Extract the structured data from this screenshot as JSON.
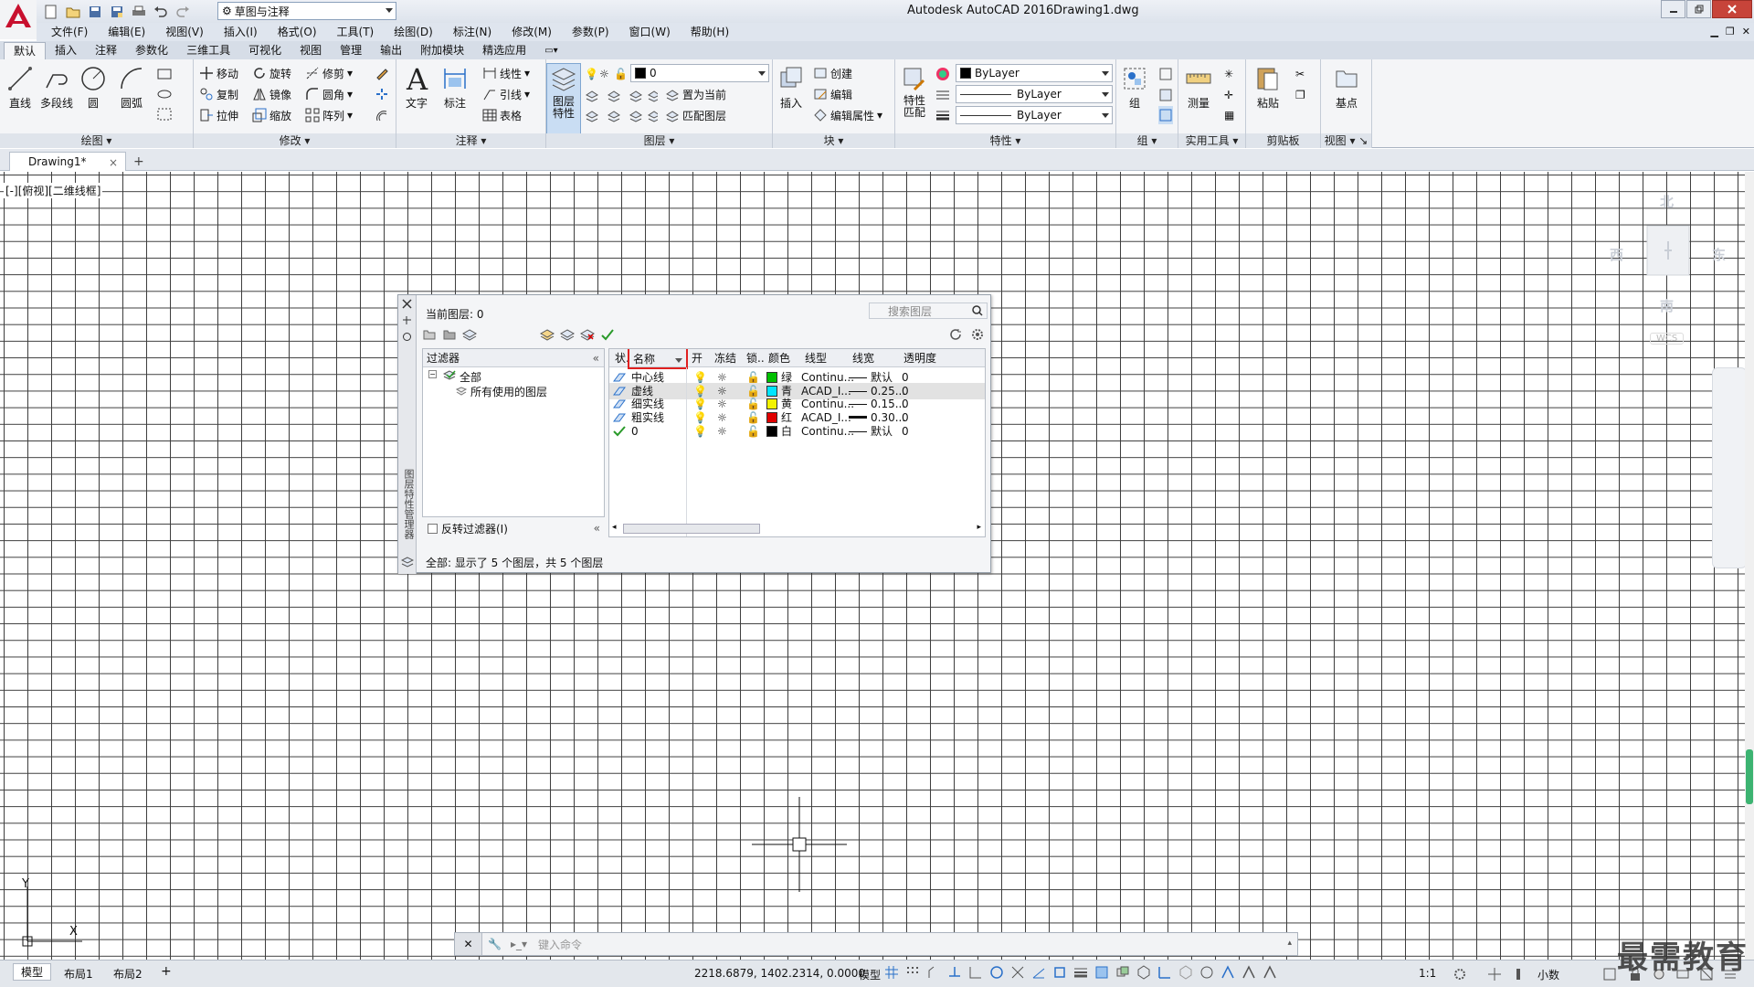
{
  "app": {
    "title": "Autodesk AutoCAD 2016",
    "document": "Drawing1.dwg",
    "workspace": "草图与注释"
  },
  "menu": [
    "文件(F)",
    "编辑(E)",
    "视图(V)",
    "插入(I)",
    "格式(O)",
    "工具(T)",
    "绘图(D)",
    "标注(N)",
    "修改(M)",
    "参数(P)",
    "窗口(W)",
    "帮助(H)"
  ],
  "ribbon_tabs": [
    "默认",
    "插入",
    "注释",
    "参数化",
    "三维工具",
    "可视化",
    "视图",
    "管理",
    "输出",
    "附加模块",
    "精选应用"
  ],
  "ribbon": {
    "draw": {
      "title": "绘图",
      "line": "直线",
      "polyline": "多段线",
      "circle": "圆",
      "arc": "圆弧"
    },
    "modify": {
      "title": "修改",
      "move": "移动",
      "rotate": "旋转",
      "trim": "修剪",
      "copy": "复制",
      "mirror": "镜像",
      "fillet": "圆角",
      "stretch": "拉伸",
      "scale": "缩放",
      "array": "阵列"
    },
    "annotation": {
      "title": "注释",
      "text": "文字",
      "dimension": "标注",
      "linear": "线性",
      "leader": "引线",
      "table": "表格"
    },
    "layers": {
      "title": "图层",
      "properties": "图层\n特性",
      "layer_current": "0",
      "set_current": "置为当前",
      "match_layer": "匹配图层"
    },
    "block": {
      "title": "块",
      "insert": "插入",
      "create": "创建",
      "edit": "编辑",
      "edit_attr": "编辑属性"
    },
    "properties": {
      "title": "特性",
      "match": "特性\n匹配",
      "color": "ByLayer",
      "linetype": "ByLayer",
      "lineweight": "ByLayer"
    },
    "groups": {
      "title": "组",
      "group": "组"
    },
    "utilities": {
      "title": "实用工具",
      "measure": "测量"
    },
    "clipboard": {
      "title": "剪贴板",
      "paste": "粘贴"
    },
    "view": {
      "title": "视图",
      "base": "基点"
    }
  },
  "doc_tab": {
    "name": "Drawing1*",
    "close": "×",
    "add": "+"
  },
  "viewport_label": "[-][俯视][二维线框]",
  "viewcube": {
    "north": "北",
    "south": "南",
    "east": "东",
    "west": "西",
    "wcs": "WCS"
  },
  "layer_manager": {
    "current_layer": "当前图层: 0",
    "search_placeholder": "搜索图层",
    "filters_header": "过滤器",
    "filter_all": "全部",
    "filter_used": "所有使用的图层",
    "invert_filter": "反转过滤器(I)",
    "side_label": "图层特性管理器",
    "columns": {
      "status": "状.",
      "name": "名称",
      "on": "开",
      "freeze": "冻结",
      "lock": "锁..",
      "color": "颜色",
      "linetype": "线型",
      "lineweight": "线宽",
      "transparency": "透明度"
    },
    "layers": [
      {
        "name": "中心线",
        "color_name": "绿",
        "color": "#00c000",
        "linetype": "Continu...",
        "lineweight": "默认",
        "transparency": "0",
        "current": false
      },
      {
        "name": "虚线",
        "color_name": "青",
        "color": "#00e5ff",
        "linetype": "ACAD_I...",
        "lineweight": "0.25...",
        "transparency": "0",
        "current": false
      },
      {
        "name": "细实线",
        "color_name": "黄",
        "color": "#f2f200",
        "linetype": "Continu...",
        "lineweight": "0.15...",
        "transparency": "0",
        "current": false
      },
      {
        "name": "粗实线",
        "color_name": "红",
        "color": "#e00000",
        "linetype": "ACAD_I...",
        "lineweight": "0.30...",
        "transparency": "0",
        "current": false
      },
      {
        "name": "0",
        "color_name": "白",
        "color": "#000000",
        "linetype": "Continu...",
        "lineweight": "默认",
        "transparency": "0",
        "current": true
      }
    ],
    "status_text": "全部: 显示了 5 个图层，共 5 个图层"
  },
  "ucs": {
    "x": "X",
    "y": "Y"
  },
  "command": {
    "placeholder": "键入命令"
  },
  "layout_tabs": [
    "模型",
    "布局1",
    "布局2"
  ],
  "status": {
    "coords": "2218.6879, 1402.2314, 0.0000",
    "model": "模型",
    "scale": "1:1",
    "units": "小数"
  },
  "watermark": "最需教育"
}
